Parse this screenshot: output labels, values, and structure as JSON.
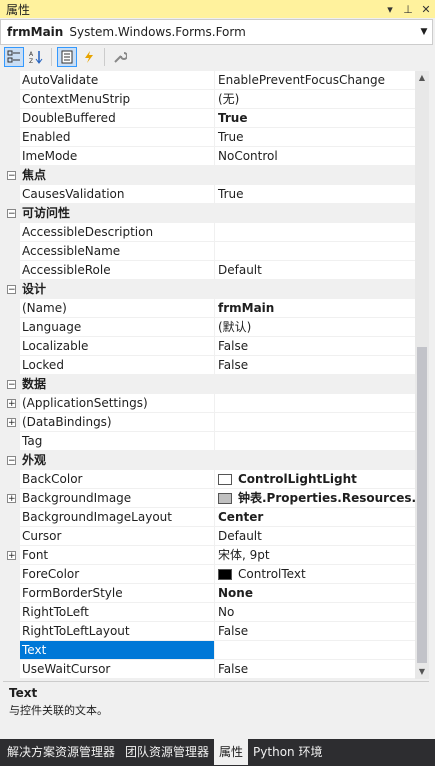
{
  "titlebar": {
    "title": "属性",
    "dropdown_glyph": "▾",
    "pin_glyph": "⊥",
    "close_glyph": "✕"
  },
  "object": {
    "name": "frmMain",
    "type": "System.Windows.Forms.Form"
  },
  "toolbar": {
    "categorized_icon": "categorized-icon",
    "alphabetical_icon": "sort-az-icon",
    "properties_icon": "properties-icon",
    "events_icon": "lightning-icon",
    "property_pages_icon": "wrench-icon"
  },
  "rows": [
    {
      "kind": "prop",
      "name": "AutoValidate",
      "value": "EnablePreventFocusChange"
    },
    {
      "kind": "prop",
      "name": "ContextMenuStrip",
      "value": "(无)"
    },
    {
      "kind": "prop",
      "name": "DoubleBuffered",
      "value": "True",
      "bold": true
    },
    {
      "kind": "prop",
      "name": "Enabled",
      "value": "True"
    },
    {
      "kind": "prop",
      "name": "ImeMode",
      "value": "NoControl"
    },
    {
      "kind": "cat",
      "name": "焦点"
    },
    {
      "kind": "prop",
      "name": "CausesValidation",
      "value": "True"
    },
    {
      "kind": "cat",
      "name": "可访问性"
    },
    {
      "kind": "prop",
      "name": "AccessibleDescription",
      "value": ""
    },
    {
      "kind": "prop",
      "name": "AccessibleName",
      "value": ""
    },
    {
      "kind": "prop",
      "name": "AccessibleRole",
      "value": "Default"
    },
    {
      "kind": "cat",
      "name": "设计"
    },
    {
      "kind": "prop",
      "name": "(Name)",
      "value": "frmMain",
      "bold": true
    },
    {
      "kind": "prop",
      "name": "Language",
      "value": "(默认)"
    },
    {
      "kind": "prop",
      "name": "Localizable",
      "value": "False"
    },
    {
      "kind": "prop",
      "name": "Locked",
      "value": "False"
    },
    {
      "kind": "cat",
      "name": "数据"
    },
    {
      "kind": "prop",
      "name": "(ApplicationSettings)",
      "value": "",
      "expand": true
    },
    {
      "kind": "prop",
      "name": "(DataBindings)",
      "value": "",
      "expand": true
    },
    {
      "kind": "prop",
      "name": "Tag",
      "value": ""
    },
    {
      "kind": "cat",
      "name": "外观"
    },
    {
      "kind": "prop",
      "name": "BackColor",
      "value": "ControlLightLight",
      "bold": true,
      "swatch": "#ffffff"
    },
    {
      "kind": "prop",
      "name": "BackgroundImage",
      "value": "钟表.Properties.Resources.Cl",
      "bold": true,
      "expand": true,
      "swatch": "#c0c0c0"
    },
    {
      "kind": "prop",
      "name": "BackgroundImageLayout",
      "value": "Center",
      "bold": true
    },
    {
      "kind": "prop",
      "name": "Cursor",
      "value": "Default"
    },
    {
      "kind": "prop",
      "name": "Font",
      "value": "宋体, 9pt",
      "expand": true
    },
    {
      "kind": "prop",
      "name": "ForeColor",
      "value": "ControlText",
      "swatch": "#000000"
    },
    {
      "kind": "prop",
      "name": "FormBorderStyle",
      "value": "None",
      "bold": true
    },
    {
      "kind": "prop",
      "name": "RightToLeft",
      "value": "No"
    },
    {
      "kind": "prop",
      "name": "RightToLeftLayout",
      "value": "False"
    },
    {
      "kind": "prop",
      "name": "Text",
      "value": "",
      "selected": true
    },
    {
      "kind": "prop",
      "name": "UseWaitCursor",
      "value": "False"
    }
  ],
  "description": {
    "title": "Text",
    "text": "与控件关联的文本。"
  },
  "tabs": [
    {
      "label": "解决方案资源管理器",
      "active": false
    },
    {
      "label": "团队资源管理器",
      "active": false
    },
    {
      "label": "属性",
      "active": true
    },
    {
      "label": "Python 环境",
      "active": false
    }
  ],
  "colors": {
    "titlebar": "#fff29d",
    "selection": "#0078d7",
    "tabbar": "#2d2d30"
  }
}
